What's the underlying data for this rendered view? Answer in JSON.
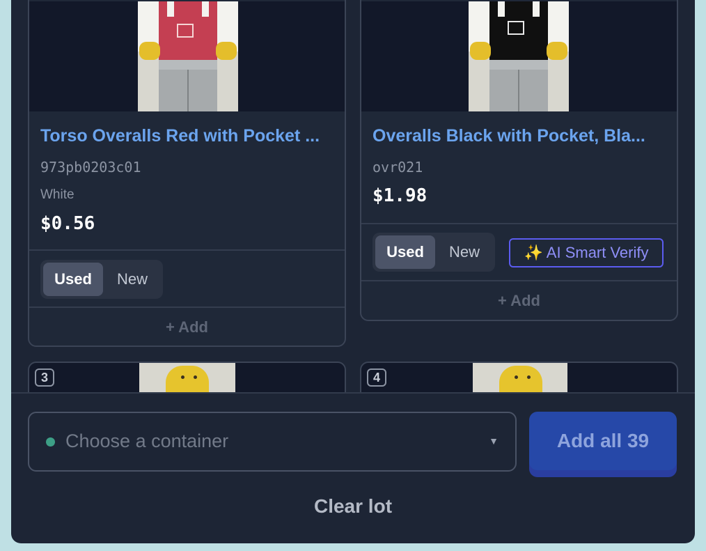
{
  "products": [
    {
      "title": "Torso Overalls Red with Pocket ...",
      "code": "973pb0203c01",
      "color": "White",
      "price": "$0.56",
      "condition_used": "Used",
      "condition_new": "New",
      "add_label": "+ Add",
      "overall_color": "#c43f52"
    },
    {
      "title": "Overalls Black with Pocket, Bla...",
      "code": "ovr021",
      "price": "$1.98",
      "condition_used": "Used",
      "condition_new": "New",
      "ai_verify_label": "✨ AI Smart Verify",
      "add_label": "+ Add",
      "overall_color": "#101010"
    },
    {
      "badge": "3"
    },
    {
      "badge": "4"
    }
  ],
  "footer": {
    "container_placeholder": "Choose a container",
    "add_all_label": "Add all 39",
    "clear_label": "Clear lot"
  },
  "colors": {
    "panel_bg": "#1d2535",
    "title_link": "#6ba4ee",
    "accent_blue": "#2648a8",
    "ai_border": "#5b5cf0",
    "status_dot": "#3d9f86"
  }
}
